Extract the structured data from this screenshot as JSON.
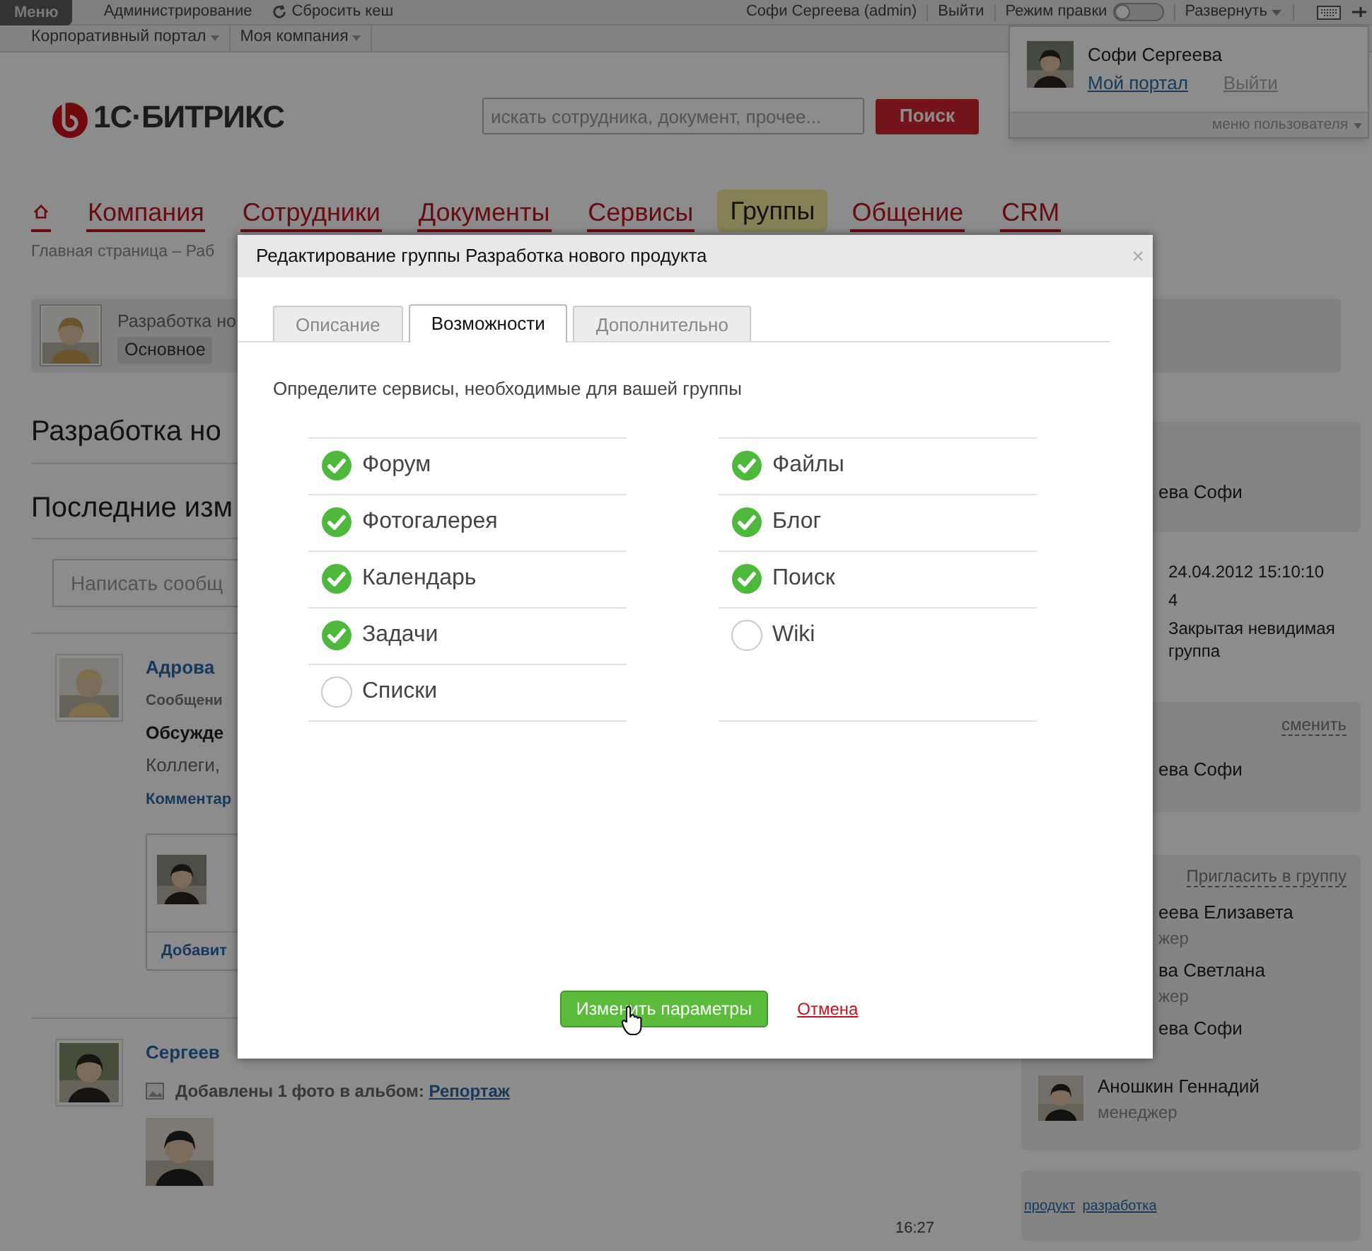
{
  "top_bar": {
    "menu_button": "Меню",
    "admin_link": "Администрирование",
    "cache_link": "Сбросить кеш",
    "user": "Софи Сергеева (admin)",
    "logout": "Выйти",
    "edit_mode": {
      "label": "Режим правки",
      "on": false
    },
    "expand": "Развернуть"
  },
  "site_menu": [
    "Корпоративный портал",
    "Моя компания"
  ],
  "user_popup": {
    "name": "Софи Сергеева",
    "portal_link": "Мой портал",
    "logout": "Выйти",
    "footer": "меню пользователя"
  },
  "logo": "1С·БИТРИКС",
  "search": {
    "placeholder": "искать сотрудника, документ, прочее...",
    "button": "Поиск"
  },
  "nav": [
    {
      "label": "Компания",
      "selected": false
    },
    {
      "label": "Сотрудники",
      "selected": false
    },
    {
      "label": "Документы",
      "selected": false
    },
    {
      "label": "Сервисы",
      "selected": false
    },
    {
      "label": "Группы",
      "selected": true
    },
    {
      "label": "Общение",
      "selected": false
    },
    {
      "label": "CRM",
      "selected": false
    }
  ],
  "breadcrumb": "Главная страница – Раб",
  "group_header": {
    "name": "Разработка но",
    "tab": "Основное"
  },
  "page_title": "Разработка но",
  "feed": {
    "title": "Последние изм",
    "composer_placeholder": "Написать сообщ",
    "posts": [
      {
        "kind": "message",
        "author": "Адрова",
        "type": "Сообщени",
        "title": "Обсужде",
        "text": "Коллеги,",
        "comments_link": "Комментар",
        "add_comment": "Добавит"
      },
      {
        "author": "Сергеев",
        "activity": "Добавлены 1 фото в альбом:",
        "album": "Репортаж"
      }
    ],
    "time": "16:27"
  },
  "sidebar": {
    "owner": "ева Софи",
    "info": [
      "24.04.2012 15:10:10",
      "4",
      "Закрытая невидимая группа"
    ],
    "moderators": {
      "action": "сменить",
      "name": "ева Софи"
    },
    "members": {
      "action": "Пригласить в группу",
      "list": [
        {
          "name": "еева Елизавета",
          "role": "жер"
        },
        {
          "name": "ва Светлана",
          "role": "жер"
        },
        {
          "name": "ева Софи"
        },
        {
          "name": "Аношкин Геннадий",
          "role": "менеджер"
        }
      ]
    },
    "tags": [
      "продукт",
      "разработка"
    ]
  },
  "dialog": {
    "title": "Редактирование группы Разработка нового продукта",
    "close": "×",
    "tabs": [
      {
        "label": "Описание",
        "selected": false
      },
      {
        "label": "Возможности",
        "selected": true
      },
      {
        "label": "Дополнительно",
        "selected": false
      }
    ],
    "prompt": "Определите сервисы, необходимые для вашей группы",
    "features_left": [
      {
        "label": "Форум",
        "checked": true
      },
      {
        "label": "Фотогалерея",
        "checked": true
      },
      {
        "label": "Календарь",
        "checked": true
      },
      {
        "label": "Задачи",
        "checked": true
      },
      {
        "label": "Списки",
        "checked": false
      }
    ],
    "features_right": [
      {
        "label": "Файлы",
        "checked": true
      },
      {
        "label": "Блог",
        "checked": true
      },
      {
        "label": "Поиск",
        "checked": true
      },
      {
        "label": "Wiki",
        "checked": false
      }
    ],
    "save_button": "Изменить параметры",
    "cancel_link": "Отмена"
  }
}
